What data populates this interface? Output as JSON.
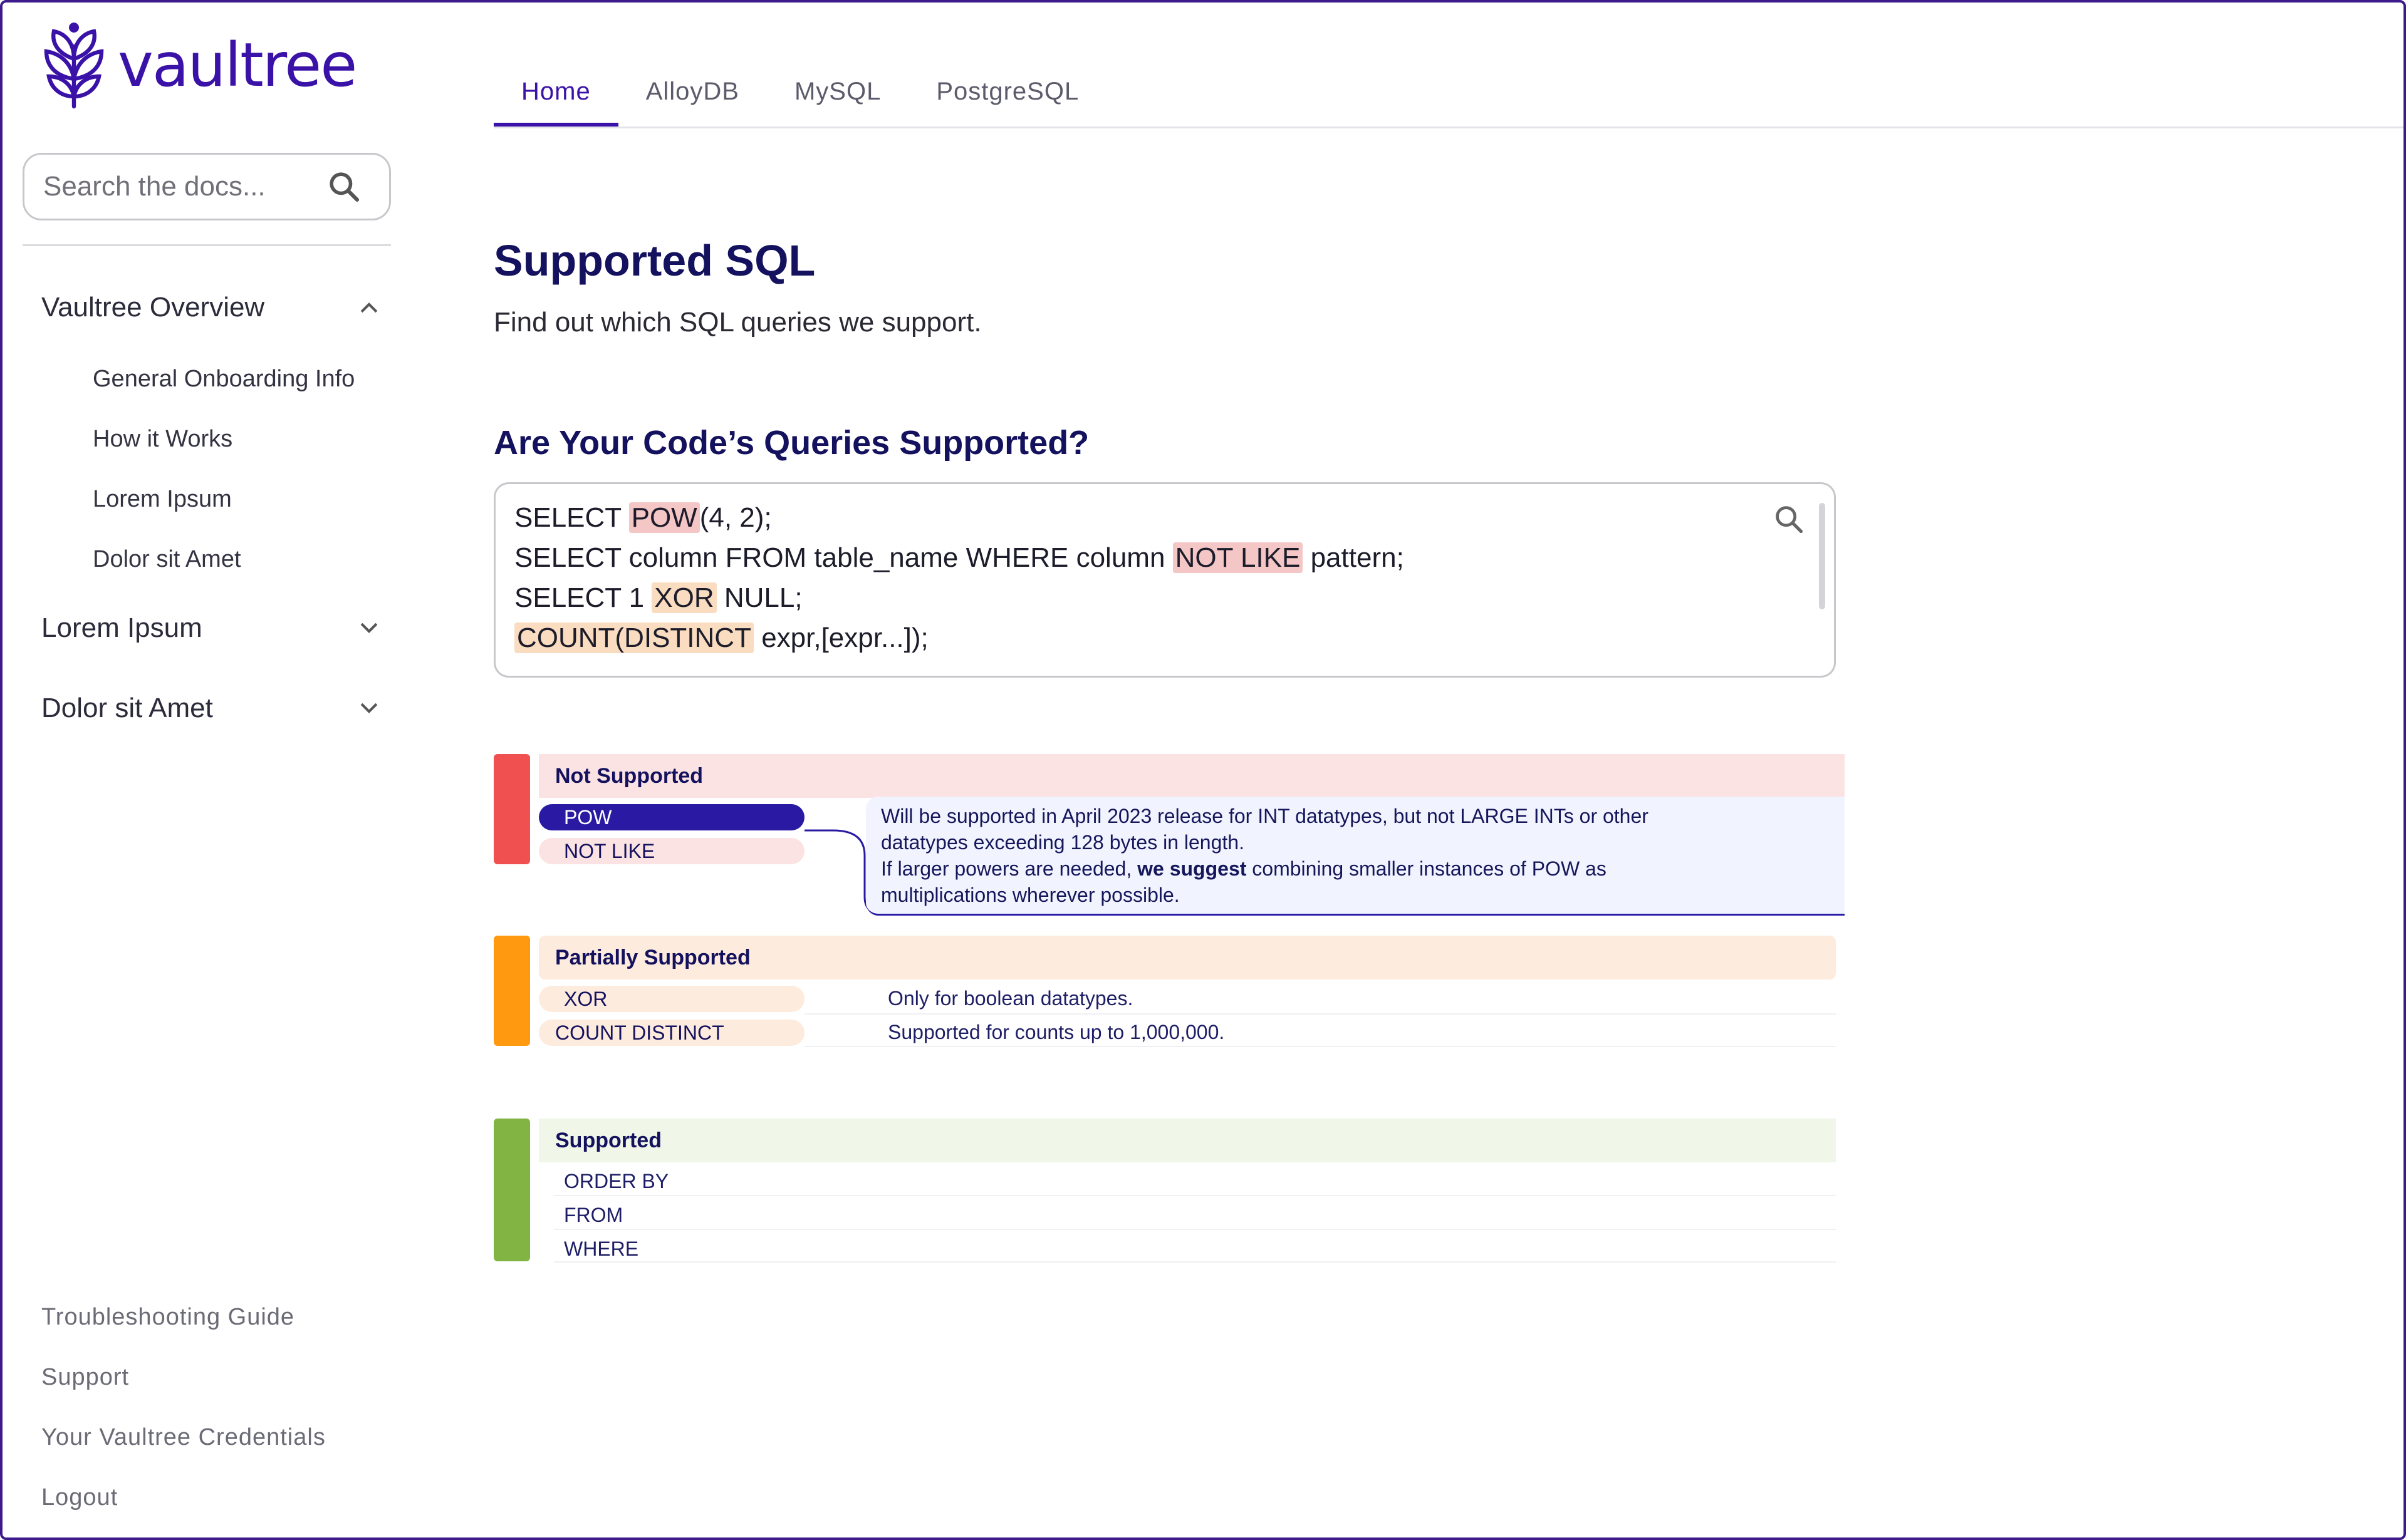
{
  "brand": {
    "name": "vaultree",
    "color": "#3a12a8"
  },
  "nav": {
    "tabs": [
      {
        "label": "Home",
        "active": true
      },
      {
        "label": "AlloyDB"
      },
      {
        "label": "MySQL"
      },
      {
        "label": "PostgreSQL"
      }
    ]
  },
  "sidebar": {
    "search_placeholder": "Search the docs...",
    "groups": [
      {
        "label": "Vaultree Overview",
        "expanded": true,
        "items": [
          "General Onboarding Info",
          "How it Works",
          "Lorem Ipsum",
          "Dolor sit Amet"
        ]
      },
      {
        "label": "Lorem Ipsum",
        "expanded": false
      },
      {
        "label": "Dolor sit Amet",
        "expanded": false
      }
    ],
    "footer": [
      "Troubleshooting Guide",
      "Support",
      "Your Vaultree Credentials",
      "Logout"
    ]
  },
  "main": {
    "title": "Supported SQL",
    "subtitle": "Find out which SQL queries we support.",
    "section_title": "Are Your Code’s Queries Supported?",
    "code": {
      "line1": {
        "a": "SELECT ",
        "b": "POW",
        "c": "(4, 2);"
      },
      "line2": {
        "a": "SELECT column FROM table_name WHERE column ",
        "b": "NOT LIKE",
        "c": " pattern;"
      },
      "line3": {
        "a": "SELECT 1 ",
        "b": "XOR",
        "c": " NULL;"
      },
      "line4": {
        "b": "COUNT(DISTINCT",
        "c": " expr,[expr...]);"
      }
    },
    "not_supported": {
      "title": "Not Supported",
      "color": "#f05050",
      "items": [
        "POW",
        "NOT LIKE"
      ],
      "detail": {
        "line1": "Will be supported in April 2023 release for INT datatypes, but not LARGE INTs or other",
        "line2": "datatypes exceeding 128 bytes in length.",
        "line3a": "If larger powers are needed, ",
        "line3b": "we suggest",
        "line3c": " combining smaller instances of POW as",
        "line4": "multiplications wherever possible."
      }
    },
    "partially_supported": {
      "title": "Partially Supported",
      "color": "#ff9a10",
      "rows": [
        {
          "name": "XOR",
          "note": "Only for boolean datatypes."
        },
        {
          "name": "COUNT DISTINCT",
          "note": "Supported for counts up to 1,000,000."
        }
      ]
    },
    "supported": {
      "title": "Supported",
      "color": "#82b444",
      "items": [
        "ORDER BY",
        "FROM",
        "WHERE"
      ]
    }
  }
}
